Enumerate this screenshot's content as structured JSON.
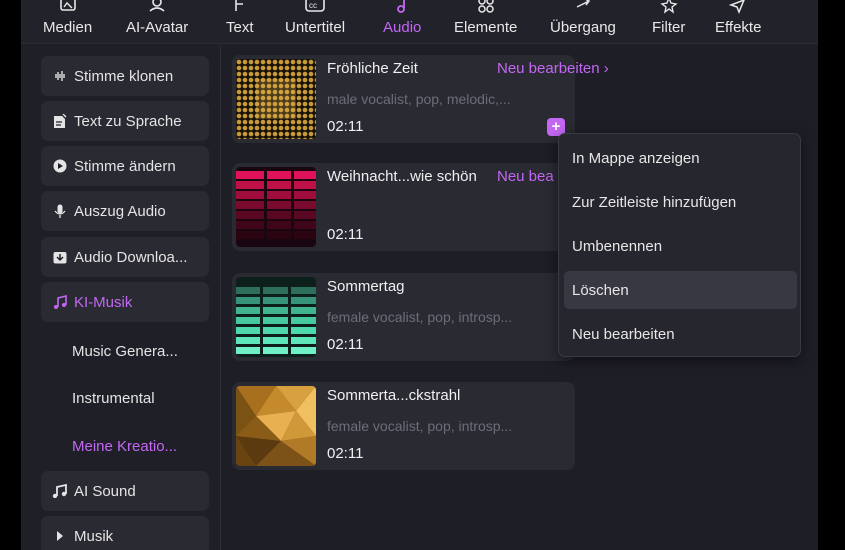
{
  "toolbar": {
    "items": [
      {
        "label": "Medien",
        "icon": "media-icon"
      },
      {
        "label": "AI-Avatar",
        "icon": "avatar-icon"
      },
      {
        "label": "Text",
        "icon": "text-icon"
      },
      {
        "label": "Untertitel",
        "icon": "subtitle-icon"
      },
      {
        "label": "Audio",
        "icon": "audio-icon"
      },
      {
        "label": "Elemente",
        "icon": "elements-icon"
      },
      {
        "label": "Übergang",
        "icon": "transition-icon"
      },
      {
        "label": "Filter",
        "icon": "filter-icon"
      },
      {
        "label": "Effekte",
        "icon": "effects-icon"
      }
    ],
    "active": "Audio"
  },
  "sidebar": {
    "items": [
      {
        "label": "Stimme klonen",
        "icon": "waveform-icon"
      },
      {
        "label": "Text zu Sprache",
        "icon": "document-speech-icon"
      },
      {
        "label": "Stimme ändern",
        "icon": "voice-change-icon"
      },
      {
        "label": "Auszug Audio",
        "icon": "microphone-icon"
      },
      {
        "label": "Audio Downloa...",
        "icon": "download-icon"
      },
      {
        "label": "KI-Musik",
        "icon": "ai-music-icon"
      },
      {
        "label": "Music Genera..."
      },
      {
        "label": "Instrumental"
      },
      {
        "label": "Meine Kreatio..."
      },
      {
        "label": "AI Sound",
        "icon": "ai-sound-icon"
      },
      {
        "label": "Musik",
        "icon": "caret-right-icon"
      }
    ]
  },
  "tracks": [
    {
      "title": "Fröhliche Zeit",
      "desc": "male vocalist, pop, melodic,...",
      "duration": "02:11",
      "edit": "Neu bearbeiten ›"
    },
    {
      "title": "Weihnacht...wie schön",
      "desc": "",
      "duration": "02:11",
      "edit": "Neu bea"
    },
    {
      "title": "Sommertag",
      "desc": "female vocalist, pop, introsp...",
      "duration": "02:11",
      "edit": ""
    },
    {
      "title": "Sommerta...ckstrahl",
      "desc": "female vocalist, pop, introsp...",
      "duration": "02:11",
      "edit": ""
    }
  ],
  "plus_label": "+",
  "context_menu": {
    "items": [
      {
        "label": "In Mappe anzeigen"
      },
      {
        "label": "Zur Zeitleiste hinzufügen"
      },
      {
        "label": "Umbenennen"
      },
      {
        "label": "Löschen"
      },
      {
        "label": "Neu bearbeiten"
      }
    ],
    "hovered": "Löschen"
  },
  "colors": {
    "accent": "#c467f5",
    "panel": "#2a2a33",
    "background": "#1e1e26"
  }
}
